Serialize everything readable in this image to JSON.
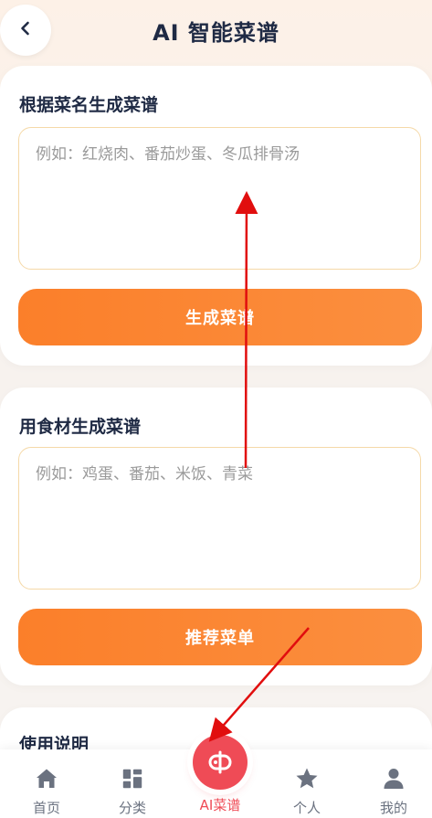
{
  "header": {
    "title": "AI 智能菜谱",
    "back_icon": "chevron-left-icon"
  },
  "section_dish": {
    "title": "根据菜名生成菜谱",
    "placeholder": "例如：红烧肉、番茄炒蛋、冬瓜排骨汤",
    "value": "",
    "button_label": "生成菜谱"
  },
  "section_ingredients": {
    "title": "用食材生成菜谱",
    "placeholder": "例如：鸡蛋、番茄、米饭、青菜",
    "value": "",
    "button_label": "推荐菜单"
  },
  "section_usage": {
    "title": "使用说明"
  },
  "bottom_nav": {
    "items": [
      {
        "label": "首页",
        "icon": "home-icon"
      },
      {
        "label": "分类",
        "icon": "grid-icon"
      },
      {
        "label": "AI菜谱",
        "icon": "ai-chef-icon"
      },
      {
        "label": "个人",
        "icon": "star-icon"
      },
      {
        "label": "我的",
        "icon": "user-icon"
      }
    ],
    "active_index": 2
  },
  "colors": {
    "accent_orange": "#fb8530",
    "nav_active": "#ef4b56",
    "title_text": "#1f2a44",
    "input_border": "#f5d9a8",
    "annotation_red": "#e10e0e"
  }
}
